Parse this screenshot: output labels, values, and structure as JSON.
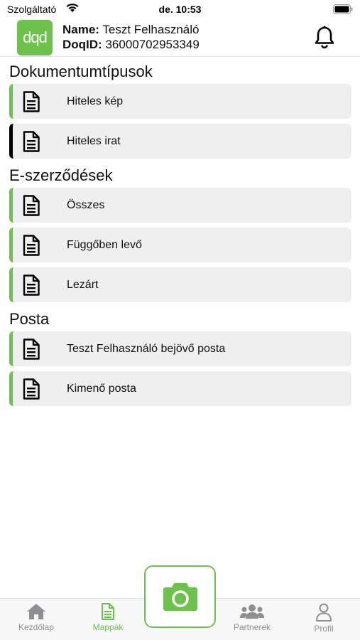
{
  "status_bar": {
    "carrier": "Szolgáltató",
    "time": "de. 10:53"
  },
  "header": {
    "logo_text": "dqd",
    "name_label": "Name:",
    "name_value": "Teszt Felhasználó",
    "doqid_label": "DoqID:",
    "doqid_value": "36000702953349"
  },
  "sections": [
    {
      "title": "Dokumentumtípusok",
      "items": [
        {
          "label": "Hiteles kép",
          "accent": "#6cc24a"
        },
        {
          "label": "Hiteles irat",
          "accent": "#000000"
        }
      ]
    },
    {
      "title": "E-szerződések",
      "items": [
        {
          "label": "Összes",
          "accent": "#6cc24a"
        },
        {
          "label": "Függőben levő",
          "accent": "#6cc24a"
        },
        {
          "label": "Lezárt",
          "accent": "#6cc24a"
        }
      ]
    },
    {
      "title": "Posta",
      "items": [
        {
          "label": "Teszt Felhasználó bejövő posta",
          "accent": "#6cc24a"
        },
        {
          "label": "Kimenő posta",
          "accent": "#6cc24a"
        }
      ]
    }
  ],
  "tabs": [
    {
      "label": "Kezdőlap",
      "icon": "home-icon",
      "active": false
    },
    {
      "label": "Mappák",
      "icon": "folder-document-icon",
      "active": true
    },
    {
      "label": "Partnerek",
      "icon": "people-icon",
      "active": false
    },
    {
      "label": "Profil",
      "icon": "person-icon",
      "active": false
    }
  ],
  "colors": {
    "accent": "#6cc24a",
    "item_bg": "#efefef",
    "inactive_tab": "#8e8e93"
  }
}
